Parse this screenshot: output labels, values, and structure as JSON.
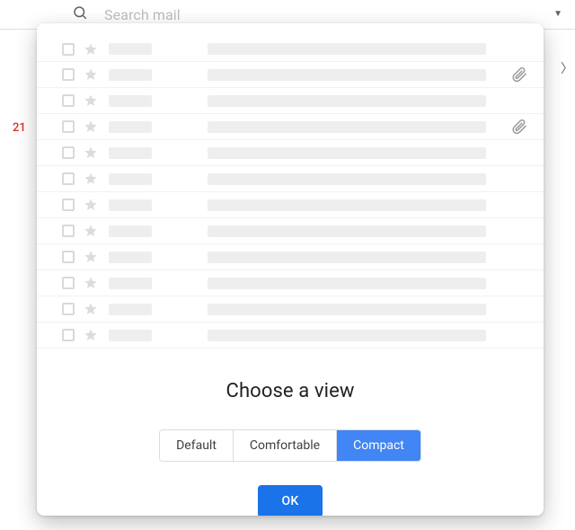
{
  "search": {
    "placeholder": "Search mail"
  },
  "sidebar": {
    "badge": "21"
  },
  "modal": {
    "title": "Choose a view",
    "options": {
      "default": "Default",
      "comfortable": "Comfortable",
      "compact": "Compact"
    },
    "selected": "compact",
    "ok": "OK",
    "preview_rows": [
      {
        "attach": false
      },
      {
        "attach": true
      },
      {
        "attach": false
      },
      {
        "attach": true
      },
      {
        "attach": false
      },
      {
        "attach": false
      },
      {
        "attach": false
      },
      {
        "attach": false
      },
      {
        "attach": false
      },
      {
        "attach": false
      },
      {
        "attach": false
      },
      {
        "attach": false
      }
    ]
  }
}
